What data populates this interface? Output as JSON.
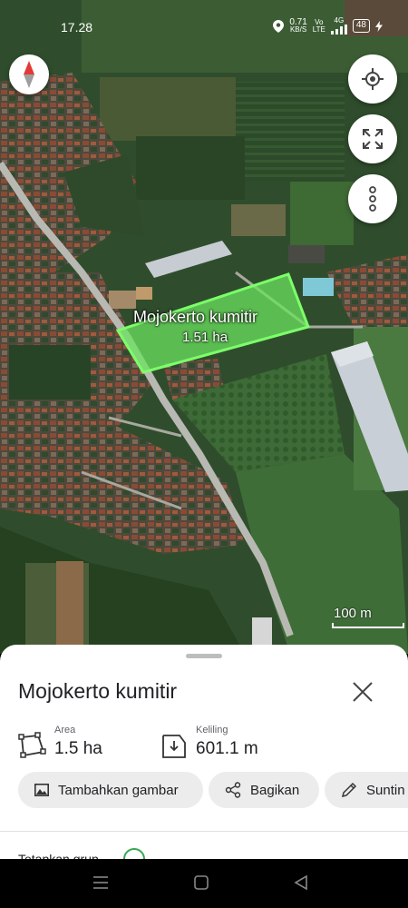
{
  "status_bar": {
    "time": "17.28",
    "net_speed": "0.71",
    "net_unit": "KB/S",
    "vo": "Vo",
    "lte": "LTE",
    "signal": "4G",
    "battery": "48"
  },
  "map": {
    "field_name": "Mojokerto kumitir",
    "field_area": "1.51 ha",
    "scale_label": "100 m",
    "field_color": "#6be35d",
    "road_color": "#b9b9b3",
    "icons": [
      "compass-icon",
      "my-location-icon",
      "fullscreen-icon",
      "more-vert-icon"
    ]
  },
  "sheet": {
    "title": "Mojokerto kumitir",
    "area_label": "Area",
    "area_value": "1.5 ha",
    "perimeter_label": "Keliling",
    "perimeter_value": "601.1 m",
    "actions": {
      "add_image": "Tambahkan gambar",
      "share": "Bagikan",
      "edit": "Suntin"
    },
    "partial_row": "Tetapkan grup"
  },
  "navbar": {
    "icons": [
      "menu-icon",
      "home-icon",
      "back-icon"
    ]
  }
}
